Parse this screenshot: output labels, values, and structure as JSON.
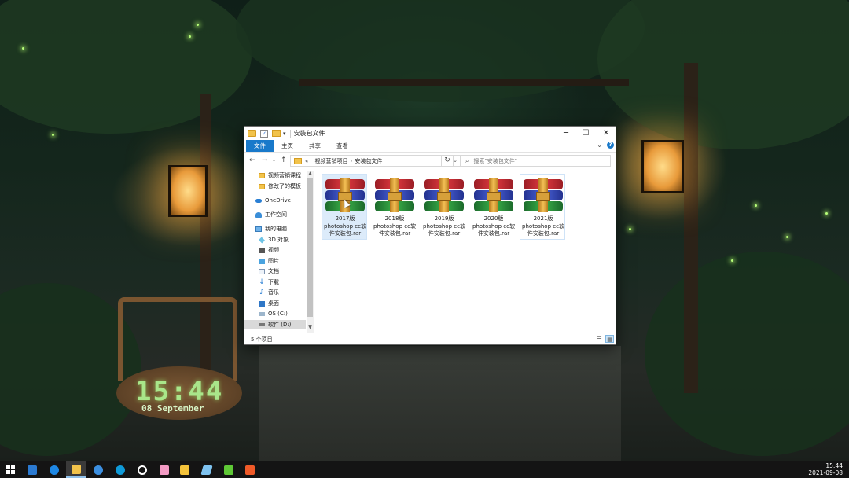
{
  "desktop": {
    "clock_time": "15:44",
    "clock_date": "08 September"
  },
  "window": {
    "title": "安装包文件",
    "ribbon_tabs": [
      "文件",
      "主页",
      "共享",
      "查看"
    ],
    "active_tab": "文件",
    "address": {
      "prefix": "«",
      "segments": [
        "视频营销项目",
        "安装包文件"
      ]
    },
    "search_placeholder": "搜索\"安装包文件\"",
    "nav_items": [
      {
        "label": "视频营销课程",
        "icon": "folder-icon"
      },
      {
        "label": "修改了的模板",
        "icon": "folder-icon"
      },
      {
        "label": "OneDrive",
        "icon": "cloud-icon"
      },
      {
        "label": "工作空间",
        "icon": "people-icon"
      },
      {
        "label": "我的电脑",
        "icon": "computer-icon"
      },
      {
        "label": "3D 对象",
        "icon": "3d-objects-icon"
      },
      {
        "label": "视频",
        "icon": "video-icon"
      },
      {
        "label": "图片",
        "icon": "pictures-icon"
      },
      {
        "label": "文档",
        "icon": "documents-icon"
      },
      {
        "label": "下载",
        "icon": "downloads-icon"
      },
      {
        "label": "音乐",
        "icon": "music-icon"
      },
      {
        "label": "桌面",
        "icon": "desktop-icon"
      },
      {
        "label": "OS (C:)",
        "icon": "os-drive-icon"
      },
      {
        "label": "软件 (D:)",
        "icon": "drive-icon"
      }
    ],
    "selected_nav": "软件 (D:)",
    "files": [
      {
        "line1": "2017版",
        "line2": "photoshop cc软",
        "line3": "件安装包.rar"
      },
      {
        "line1": "2018版",
        "line2": "photoshop cc软",
        "line3": "件安装包.rar"
      },
      {
        "line1": "2019版",
        "line2": "photoshop cc软",
        "line3": "件安装包.rar"
      },
      {
        "line1": "2020版",
        "line2": "photoshop cc软",
        "line3": "件安装包.rar"
      },
      {
        "line1": "2021版",
        "line2": "photoshop cc软",
        "line3": "件安装包.rar"
      }
    ],
    "status_text": "5 个项目"
  },
  "taskbar": {
    "time": "15:44",
    "date": "2021-09-08",
    "apps": [
      {
        "name": "start",
        "color": "#ffffff"
      },
      {
        "name": "app-blue-square",
        "color": "#2b7ad1"
      },
      {
        "name": "search-app",
        "color": "#1e88e5"
      },
      {
        "name": "file-explorer",
        "color": "#f2c34b"
      },
      {
        "name": "globe-app",
        "color": "#3c8fe0"
      },
      {
        "name": "edge-browser",
        "color": "#0f9ad8"
      },
      {
        "name": "dell-app",
        "color": "#ffffff"
      },
      {
        "name": "pink-app",
        "color": "#f39bc4"
      },
      {
        "name": "yellow-app",
        "color": "#f3c23a"
      },
      {
        "name": "pen-app",
        "color": "#7fc3f0"
      },
      {
        "name": "green-c-app",
        "color": "#5fc836"
      },
      {
        "name": "orange-app",
        "color": "#f05a28"
      }
    ]
  }
}
